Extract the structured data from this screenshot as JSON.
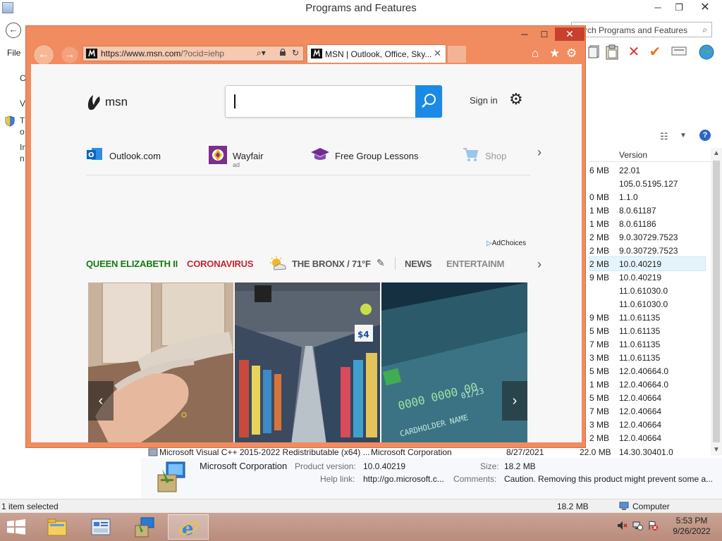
{
  "pf": {
    "title": "Programs and Features",
    "min": "─",
    "max": "❐",
    "close": "✕",
    "search_placeholder": "rch Programs and Features",
    "menu_file": "File",
    "left_stub": [
      "C",
      "V",
      "T",
      "o",
      "In",
      "n"
    ],
    "column_version": "Version",
    "rows": [
      {
        "size": "6 MB",
        "version": "22.01"
      },
      {
        "size": "",
        "version": "105.0.5195.127"
      },
      {
        "size": "0 MB",
        "version": "1.1.0"
      },
      {
        "size": "1 MB",
        "version": "8.0.61187"
      },
      {
        "size": "1 MB",
        "version": "8.0.61186"
      },
      {
        "size": "2 MB",
        "version": "9.0.30729.7523"
      },
      {
        "size": "2 MB",
        "version": "9.0.30729.7523"
      },
      {
        "size": "2 MB",
        "version": "10.0.40219"
      },
      {
        "size": "9 MB",
        "version": "10.0.40219"
      },
      {
        "size": "",
        "version": "11.0.61030.0"
      },
      {
        "size": "",
        "version": "11.0.61030.0"
      },
      {
        "size": "9 MB",
        "version": "11.0.61135"
      },
      {
        "size": "5 MB",
        "version": "11.0.61135"
      },
      {
        "size": "7 MB",
        "version": "11.0.61135"
      },
      {
        "size": "3 MB",
        "version": "11.0.61135"
      },
      {
        "size": "5 MB",
        "version": "12.0.40664.0"
      },
      {
        "size": "1 MB",
        "version": "12.0.40664.0"
      },
      {
        "size": "5 MB",
        "version": "12.0.40664"
      },
      {
        "size": "7 MB",
        "version": "12.0.40664"
      },
      {
        "size": "3 MB",
        "version": "12.0.40664"
      },
      {
        "size": "2 MB",
        "version": "12.0.40664"
      }
    ],
    "last_row": {
      "name": "Microsoft Visual C++ 2015-2022 Redistributable (x64) ...",
      "publisher": "Microsoft Corporation",
      "installed": "8/27/2021",
      "size": "22.0 MB",
      "version": "14.30.30401.0"
    },
    "details": {
      "publisher": "Microsoft Corporation",
      "product_version_label": "Product version:",
      "product_version": "10.0.40219",
      "size_label": "Size:",
      "size": "18.2 MB",
      "help_label": "Help link:",
      "help": "http://go.microsoft.c...",
      "comments_label": "Comments:",
      "comments": "Caution. Removing this product might prevent some a..."
    },
    "status": {
      "selected": "1 item selected",
      "size": "18.2 MB",
      "location": "Computer"
    }
  },
  "ie": {
    "url_main": "https://www.msn.com",
    "url_rest": "/?ocid=iehp",
    "tab_title": "MSN | Outlook, Office, Sky...",
    "tab_close": "✕",
    "min": "─",
    "max": "☐",
    "close": "✕"
  },
  "msn": {
    "logo_text": "msn",
    "sign_in": "Sign in",
    "quick_links": [
      {
        "label": "Outlook.com"
      },
      {
        "label": "Wayfair",
        "badge": "ad"
      },
      {
        "label": "Free Group Lessons"
      },
      {
        "label": "Shop"
      }
    ],
    "ad_choices": "AdChoices",
    "topics": [
      {
        "label": "QUEEN ELIZABETH II",
        "color": "#107c10"
      },
      {
        "label": "CORONAVIRUS",
        "color": "#c4262e"
      },
      {
        "label": "THE BRONX / 71°F",
        "color": "#555555"
      },
      {
        "label": "NEWS",
        "color": "#555555"
      },
      {
        "label": "ENTERTAINM",
        "color": "#8a8a8a"
      }
    ],
    "card_text_1": "0000 0000 00",
    "card_text_2": "01/23",
    "card_text_3": "CARDHOLDER NAME"
  },
  "taskbar": {
    "time": "5:53 PM",
    "date": "9/26/2022"
  },
  "colors": {
    "ie_frame": "#f08c5f",
    "msn_blue": "#1a8ae6",
    "close_red": "#c7412e"
  }
}
